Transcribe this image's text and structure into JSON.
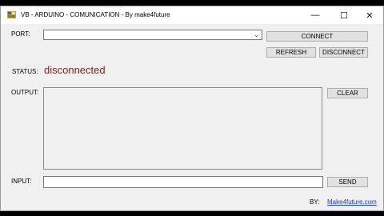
{
  "window": {
    "title": "VB - ARDUINO - COMUNICATION - By make4future",
    "minimize_glyph": "—",
    "maximize_glyph": "☐",
    "close_glyph": "✕"
  },
  "port": {
    "label": "PORT:",
    "value": ""
  },
  "buttons": {
    "connect": "CONNECT",
    "refresh": "REFRESH",
    "disconnect": "DISCONNECT",
    "clear": "CLEAR",
    "send": "SEND"
  },
  "status": {
    "label": "STATUS:",
    "value": "disconnected"
  },
  "output": {
    "label": "OUTPUT:",
    "value": ""
  },
  "input": {
    "label": "INPUT:",
    "value": ""
  },
  "footer": {
    "by_label": "BY:",
    "link": "Make4future.com"
  },
  "colors": {
    "status": "#8b1a1a",
    "link": "#1a3fb4"
  }
}
